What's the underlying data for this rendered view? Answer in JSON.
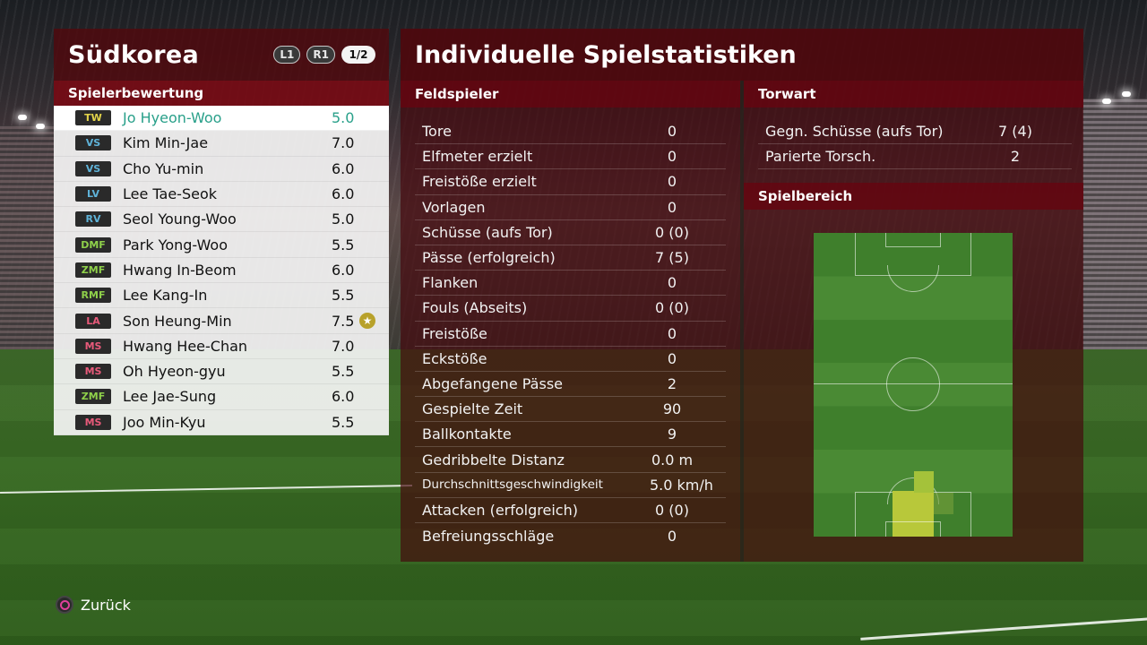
{
  "left_panel": {
    "team_name": "Südkorea",
    "buttons": {
      "l1": "L1",
      "r1": "R1",
      "page": "1/2"
    },
    "section_title": "Spielerbewertung",
    "players": [
      {
        "pos": "TW",
        "pos_color": "#e3d44a",
        "name": "Jo Hyeon-Woo",
        "rating": "5.0",
        "selected": true
      },
      {
        "pos": "VS",
        "pos_color": "#5fb3d9",
        "name": "Kim Min-Jae",
        "rating": "7.0"
      },
      {
        "pos": "VS",
        "pos_color": "#5fb3d9",
        "name": "Cho Yu-min",
        "rating": "6.0"
      },
      {
        "pos": "LV",
        "pos_color": "#5fb3d9",
        "name": "Lee Tae-Seok",
        "rating": "6.0"
      },
      {
        "pos": "RV",
        "pos_color": "#5fb3d9",
        "name": "Seol Young-Woo",
        "rating": "5.0"
      },
      {
        "pos": "DMF",
        "pos_color": "#8fd04a",
        "name": "Park Yong-Woo",
        "rating": "5.5"
      },
      {
        "pos": "ZMF",
        "pos_color": "#8fd04a",
        "name": "Hwang In-Beom",
        "rating": "6.0"
      },
      {
        "pos": "RMF",
        "pos_color": "#8fd04a",
        "name": "Lee Kang-In",
        "rating": "5.5"
      },
      {
        "pos": "LA",
        "pos_color": "#e85a7a",
        "name": "Son Heung-Min",
        "rating": "7.5",
        "star": true
      },
      {
        "pos": "MS",
        "pos_color": "#e85a7a",
        "name": "Hwang Hee-Chan",
        "rating": "7.0"
      },
      {
        "pos": "MS",
        "pos_color": "#e85a7a",
        "name": "Oh Hyeon-gyu",
        "rating": "5.5"
      },
      {
        "pos": "ZMF",
        "pos_color": "#8fd04a",
        "name": "Lee Jae-Sung",
        "rating": "6.0"
      },
      {
        "pos": "MS",
        "pos_color": "#e85a7a",
        "name": "Joo Min-Kyu",
        "rating": "5.5"
      }
    ],
    "star_icon": "star-icon"
  },
  "right_panel": {
    "title": "Individuelle Spielstatistiken",
    "field_heading": "Feldspieler",
    "gk_heading": "Torwart",
    "area_heading": "Spielbereich",
    "field_stats": [
      {
        "label": "Tore",
        "value": "0"
      },
      {
        "label": "Elfmeter erzielt",
        "value": "0"
      },
      {
        "label": "Freistöße erzielt",
        "value": "0"
      },
      {
        "label": "Vorlagen",
        "value": "0"
      },
      {
        "label": "Schüsse (aufs Tor)",
        "value": "0 (0)"
      },
      {
        "label": "Pässe (erfolgreich)",
        "value": "7 (5)"
      },
      {
        "label": "Flanken",
        "value": "0"
      },
      {
        "label": "Fouls (Abseits)",
        "value": "0 (0)"
      },
      {
        "label": "Freistöße",
        "value": "0"
      },
      {
        "label": "Eckstöße",
        "value": "0"
      },
      {
        "label": "Abgefangene Pässe",
        "value": "2"
      },
      {
        "label": "Gespielte Zeit",
        "value": "90"
      },
      {
        "label": "Ballkontakte",
        "value": "9"
      },
      {
        "label": "Gedribbelte Distanz",
        "value": "0.0 m"
      },
      {
        "label": "Durchschnittsgeschwindigkeit",
        "value": "5.0 km/h",
        "small": true
      },
      {
        "label": "Attacken (erfolgreich)",
        "value": "0 (0)"
      },
      {
        "label": "Befreiungsschläge",
        "value": "0"
      }
    ],
    "gk_stats": [
      {
        "label": "Gegn. Schüsse (aufs Tor)",
        "value": "7 (4)"
      },
      {
        "label": "Parierte Torsch.",
        "value": "2"
      }
    ]
  },
  "footer": {
    "back_label": "Zurück",
    "back_icon": "circle-button-icon"
  }
}
